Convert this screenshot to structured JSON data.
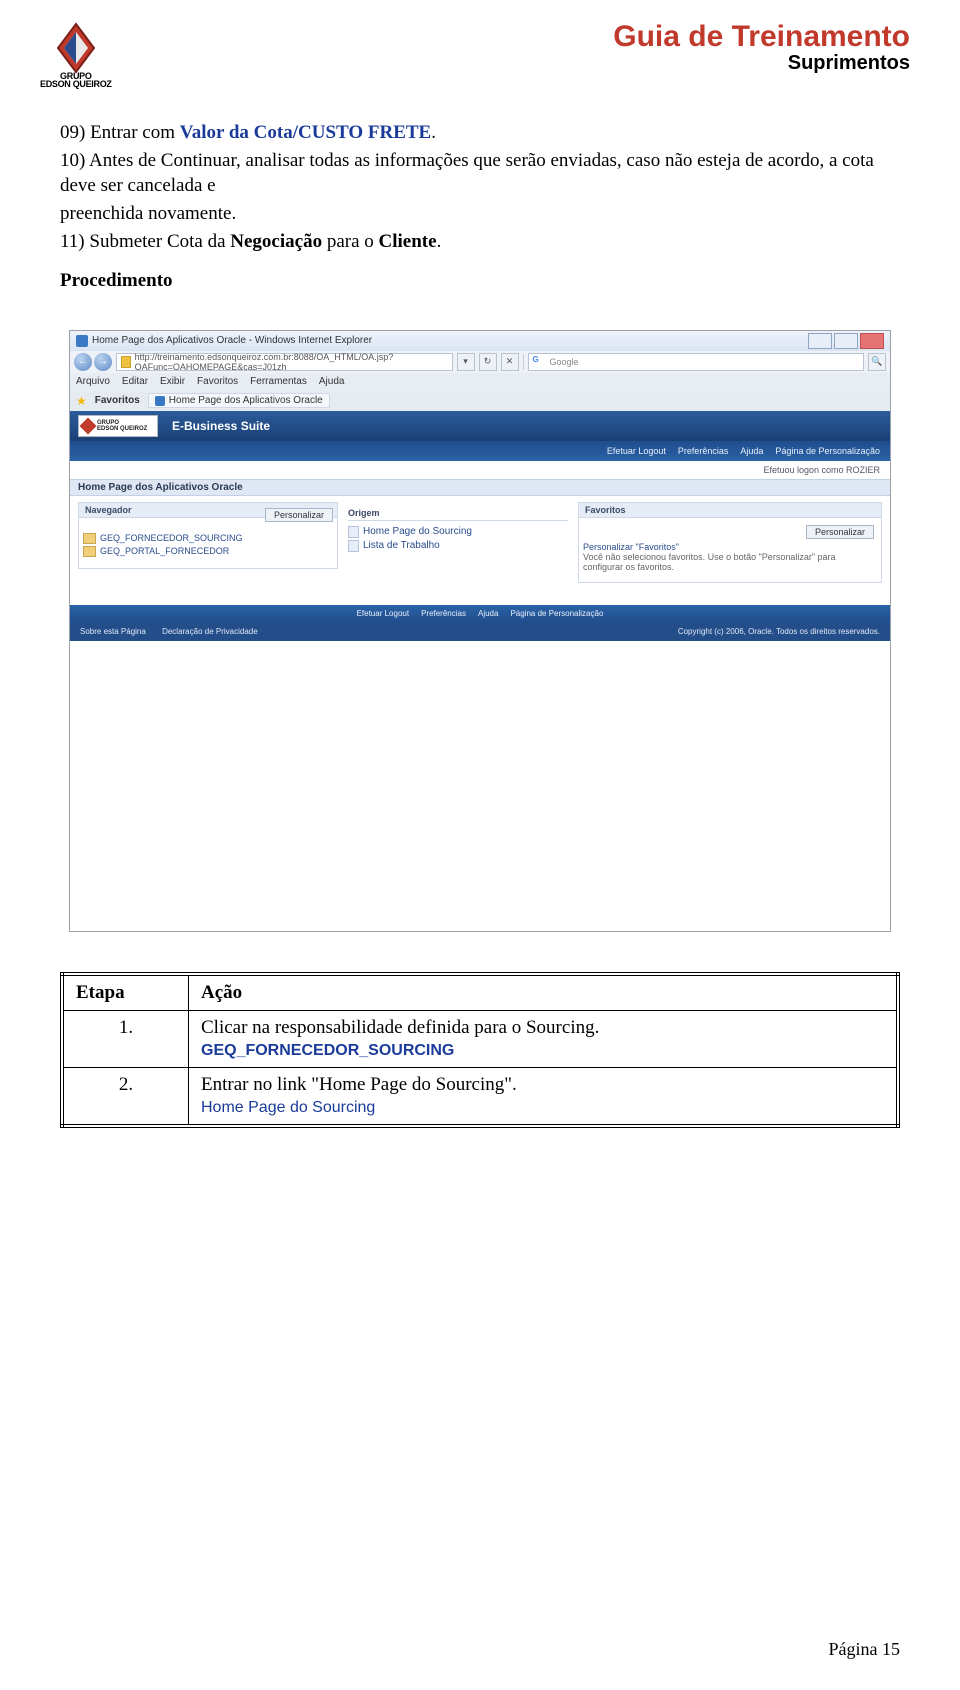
{
  "header": {
    "logo_top": "GRUPO",
    "logo_bottom": "EDSON QUEIROZ",
    "title": "Guia de Treinamento",
    "subtitle": "Suprimentos"
  },
  "body": {
    "line09_prefix": "09) Entrar com ",
    "line09_bold1": "Valor da Cota/CUSTO FRETE",
    "line09_suffix": ".",
    "line10": "10) Antes de Continuar, analisar todas as informações que serão enviadas, caso não esteja de acordo, a cota deve ser cancelada e",
    "line10b": "preenchida novamente.",
    "line11_prefix": "11) Submeter Cota da ",
    "line11_bold1": "Negociação",
    "line11_mid": " para o ",
    "line11_bold2": "Cliente",
    "line11_suffix": ".",
    "procedimento": "Procedimento"
  },
  "ie": {
    "title": "Home Page dos Aplicativos Oracle - Windows Internet Explorer",
    "url": "http://treinamento.edsonqueiroz.com.br:8088/OA_HTML/OA.jsp?OAFunc=OAHOMEPAGE&cas=J01zh",
    "search_placeholder": "Google",
    "menu": [
      "Arquivo",
      "Editar",
      "Exibir",
      "Favoritos",
      "Ferramentas",
      "Ajuda"
    ],
    "fav_label": "Favoritos",
    "tab_label": "Home Page dos Aplicativos Oracle"
  },
  "app": {
    "logo_top": "GRUPO",
    "logo_bottom": "EDSON QUEIROZ",
    "ebs": "E-Business Suite",
    "links": [
      "Efetuar Logout",
      "Preferências",
      "Ajuda",
      "Página de Personalização"
    ],
    "login_as": "Efetuou logon como ROZIER",
    "home_title": "Home Page dos Aplicativos Oracle"
  },
  "panels": {
    "navegador": "Navegador",
    "personalizar": "Personalizar",
    "tree1": "GEQ_FORNECEDOR_SOURCING",
    "tree2": "GEQ_PORTAL_FORNECEDOR",
    "origem": "Origem",
    "origem_items": [
      "Home Page do Sourcing",
      "Lista de Trabalho"
    ],
    "favoritos": "Favoritos",
    "fav_hint1": "Personalizar \"Favoritos\"",
    "fav_hint2": "Você não selecionou favoritos. Use o botão \"Personalizar\" para configurar os favoritos."
  },
  "footer": {
    "links": [
      "Efetuar Logout",
      "Preferências",
      "Ajuda",
      "Página de Personalização"
    ],
    "about": "Sobre esta Página",
    "privacy": "Declaração de Privacidade",
    "copyright": "Copyright (c) 2006, Oracle. Todos os direitos reservados."
  },
  "table": {
    "h_etapa": "Etapa",
    "h_acao": "Ação",
    "r1_num": "1.",
    "r1_text": "Clicar na responsabilidade definida para o Sourcing.",
    "r1_link": "GEQ_FORNECEDOR_SOURCING",
    "r2_num": "2.",
    "r2_text": "Entrar no link \"Home Page do Sourcing\".",
    "r2_link": "Home Page do Sourcing"
  },
  "pagefoot": "Página 15"
}
